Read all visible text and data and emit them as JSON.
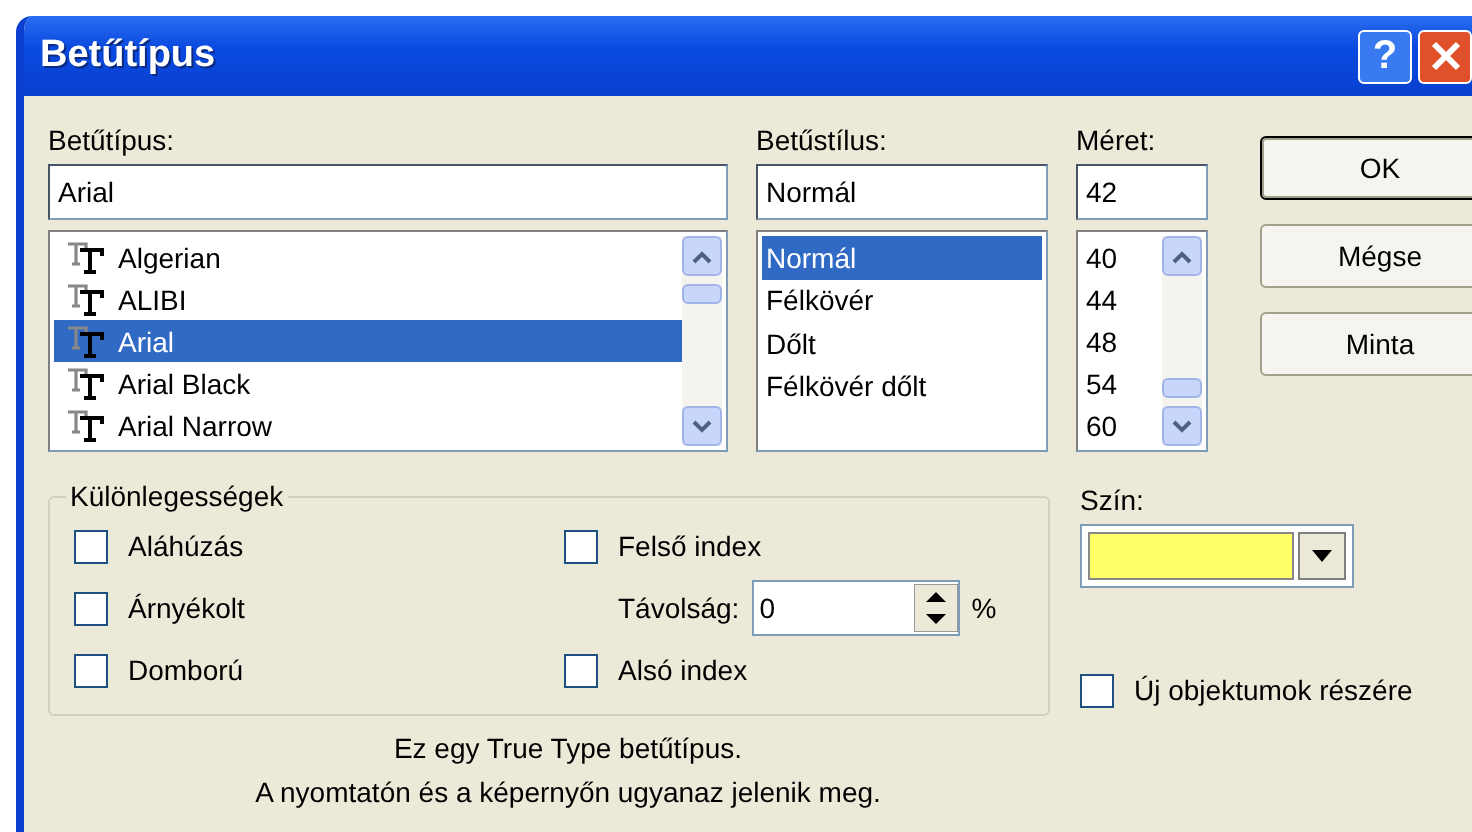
{
  "window": {
    "title": "Betűtípus",
    "help": "?"
  },
  "font": {
    "label": "Betűtípus:",
    "value": "Arial",
    "items": [
      {
        "name": "Algerian",
        "selected": false
      },
      {
        "name": "ALIBI",
        "selected": false
      },
      {
        "name": "Arial",
        "selected": true
      },
      {
        "name": "Arial Black",
        "selected": false
      },
      {
        "name": "Arial Narrow",
        "selected": false
      }
    ]
  },
  "style": {
    "label": "Betűstílus:",
    "value": "Normál",
    "items": [
      {
        "name": "Normál",
        "selected": true
      },
      {
        "name": "Félkövér",
        "selected": false
      },
      {
        "name": "Dőlt",
        "selected": false
      },
      {
        "name": "Félkövér dőlt",
        "selected": false
      }
    ]
  },
  "size": {
    "label": "Méret:",
    "value": "42",
    "items": [
      {
        "name": "40",
        "selected": false
      },
      {
        "name": "44",
        "selected": false
      },
      {
        "name": "48",
        "selected": false
      },
      {
        "name": "54",
        "selected": false
      },
      {
        "name": "60",
        "selected": false
      }
    ]
  },
  "buttons": [
    {
      "label": "OK",
      "default": true
    },
    {
      "label": "Mégse",
      "default": false
    },
    {
      "label": "Minta",
      "default": false
    }
  ],
  "effects": {
    "title": "Különlegességek",
    "left": [
      {
        "label": "Aláhúzás",
        "checked": false
      },
      {
        "label": "Árnyékolt",
        "checked": false
      },
      {
        "label": "Domború",
        "checked": false
      }
    ],
    "superscript": {
      "label": "Felső index",
      "checked": false
    },
    "offset": {
      "label": "Távolság:",
      "value": "0",
      "unit": "%"
    },
    "subscript": {
      "label": "Alsó index",
      "checked": false
    }
  },
  "color": {
    "label": "Szín:",
    "color": "#ffff66"
  },
  "default_for_new": {
    "label": "Új objektumok részére",
    "checked": false
  },
  "description": [
    "Ez egy True Type betűtípus.",
    "A nyomtatón és a képernyőn ugyanaz jelenik meg."
  ]
}
